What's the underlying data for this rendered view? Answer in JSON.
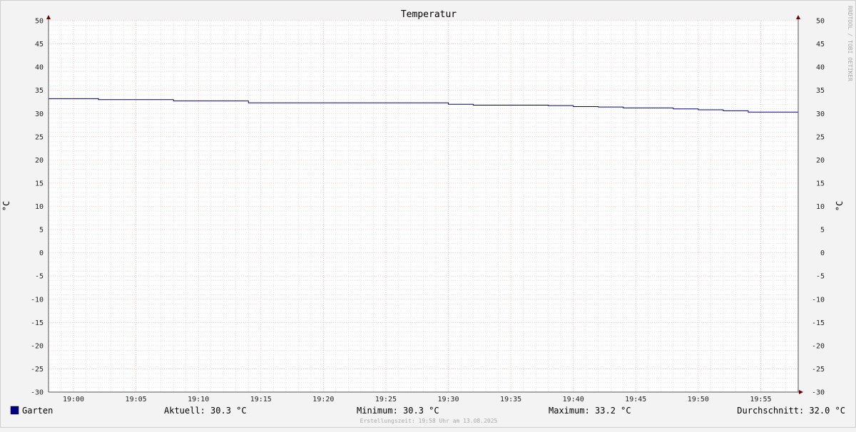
{
  "colors": {
    "series": "#000080",
    "major_grid": "#f0a0a0",
    "minor_grid": "#c8c8c8",
    "axis": "#700000",
    "background": "#f3f3f3",
    "plot_bg": "#ffffff"
  },
  "watermark": "RRDTOOL / TOBI OETIKER",
  "footer": "Erstellungszeit: 19:58 Uhr am 13.08.2025",
  "legend": {
    "series_label": "Garten",
    "current": "Aktuell: 30.3 °C",
    "minimum": "Minimum: 30.3 °C",
    "maximum": "Maximum: 33.2 °C",
    "average": "Durchschnitt: 32.0 °C"
  },
  "chart_data": {
    "type": "line",
    "title": "Temperatur",
    "ylabel": "°C",
    "ylabel_right": "°C",
    "ylim": [
      -30,
      50
    ],
    "y_ticks": [
      -30,
      -25,
      -20,
      -15,
      -10,
      -5,
      0,
      5,
      10,
      15,
      20,
      25,
      30,
      35,
      40,
      45,
      50
    ],
    "xlim": [
      "18:58",
      "19:58"
    ],
    "x_ticks": [
      "19:00",
      "19:05",
      "19:10",
      "19:15",
      "19:20",
      "19:25",
      "19:30",
      "19:35",
      "19:40",
      "19:45",
      "19:50",
      "19:55"
    ],
    "grid": true,
    "series": [
      {
        "name": "Garten",
        "step": true,
        "x": [
          "18:58",
          "19:02",
          "19:08",
          "19:14",
          "19:30",
          "19:32",
          "19:38",
          "19:40",
          "19:42",
          "19:44",
          "19:48",
          "19:50",
          "19:52",
          "19:54",
          "19:58"
        ],
        "y": [
          33.2,
          33.0,
          32.7,
          32.3,
          32.0,
          31.8,
          31.7,
          31.5,
          31.4,
          31.2,
          31.0,
          30.8,
          30.6,
          30.3,
          30.3
        ]
      }
    ]
  }
}
